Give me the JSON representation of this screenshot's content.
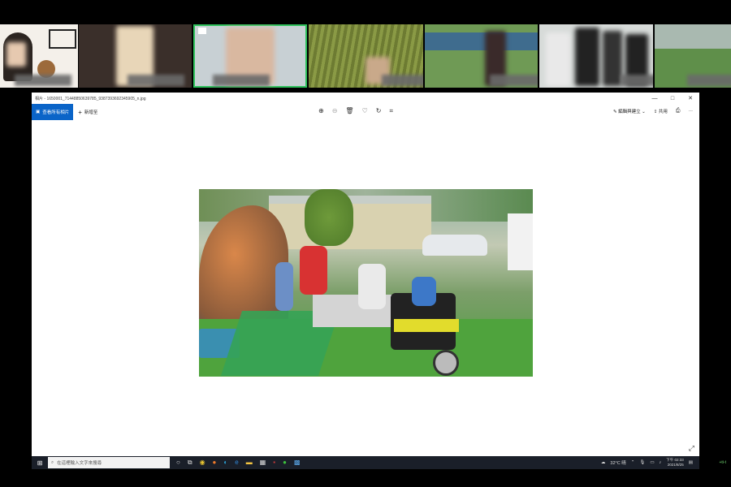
{
  "participants": [
    {
      "name": "participant-1"
    },
    {
      "name": "participant-2"
    },
    {
      "name": "participant-3"
    },
    {
      "name": "participant-4"
    },
    {
      "name": "participant-5"
    },
    {
      "name": "participant-6"
    },
    {
      "name": "participant-7"
    }
  ],
  "window": {
    "title": "相片 - 1650001_71448850639785_9387393692345905_n.jpg",
    "minimize": "—",
    "maximize": "□",
    "close": "✕"
  },
  "toolbar": {
    "primary_label": "查看所有相片",
    "add_label": "新增至",
    "edit_create_label": "編輯與建立",
    "share_label": "共用",
    "more_label": "···",
    "print_icon": "printer-icon"
  },
  "taskbar": {
    "search_placeholder": "在這裡輸入文字來搜尋",
    "weather": "32°C 晴",
    "time": "下午 02:33",
    "date": "2021/8/25",
    "right_edge": "+ti-t"
  }
}
